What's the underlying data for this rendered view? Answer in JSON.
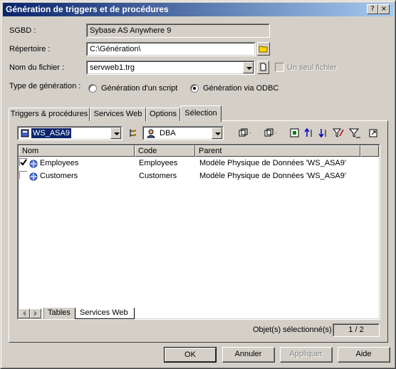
{
  "window": {
    "title": "Génération de triggers et de procédures",
    "title_controls": [
      "?",
      "×"
    ]
  },
  "form": {
    "sgbd_label": "SGBD :",
    "sgbd_value": "Sybase AS Anywhere 9",
    "repertoire_label": "Répertoire :",
    "repertoire_value": "C:\\Génération\\",
    "fichier_label": "Nom du fichier :",
    "fichier_value": "servweb1.trg",
    "seul_fichier_label": "Un seul fichier",
    "type_label": "Type de génération :",
    "radio_script_label": "Génération d'un script",
    "radio_odbc_label": "Génération via ODBC",
    "selected_radio": "odbc"
  },
  "tabs": [
    {
      "label": "Triggers & procédures",
      "active": false
    },
    {
      "label": "Services Web",
      "active": false
    },
    {
      "label": "Options",
      "active": false
    },
    {
      "label": "Sélection",
      "active": true
    }
  ],
  "selection": {
    "model_value": "WS_ASA9",
    "owner_value": "DBA",
    "columns": [
      "Nom",
      "Code",
      "Parent"
    ],
    "rows": [
      {
        "checked": true,
        "nom": "Employees",
        "code": "Employees",
        "parent": "Modèle Physique de Données 'WS_ASA9'"
      },
      {
        "checked": false,
        "nom": "Customers",
        "code": "Customers",
        "parent": "Modèle Physique de Données 'WS_ASA9'"
      }
    ],
    "sheet_tabs": [
      "Tables",
      "Services Web"
    ],
    "active_sheet_tab": "Services Web",
    "status_label": "Objet(s) sélectionné(s) :",
    "status_value": "1 / 2"
  },
  "buttons": {
    "ok": "OK",
    "annuler": "Annuler",
    "appliquer": "Appliquer",
    "aide": "Aide"
  },
  "colors": {
    "title_start": "#0a246a",
    "title_end": "#a6caf0",
    "face": "#d4d0c8",
    "selection": "#0a246a"
  }
}
